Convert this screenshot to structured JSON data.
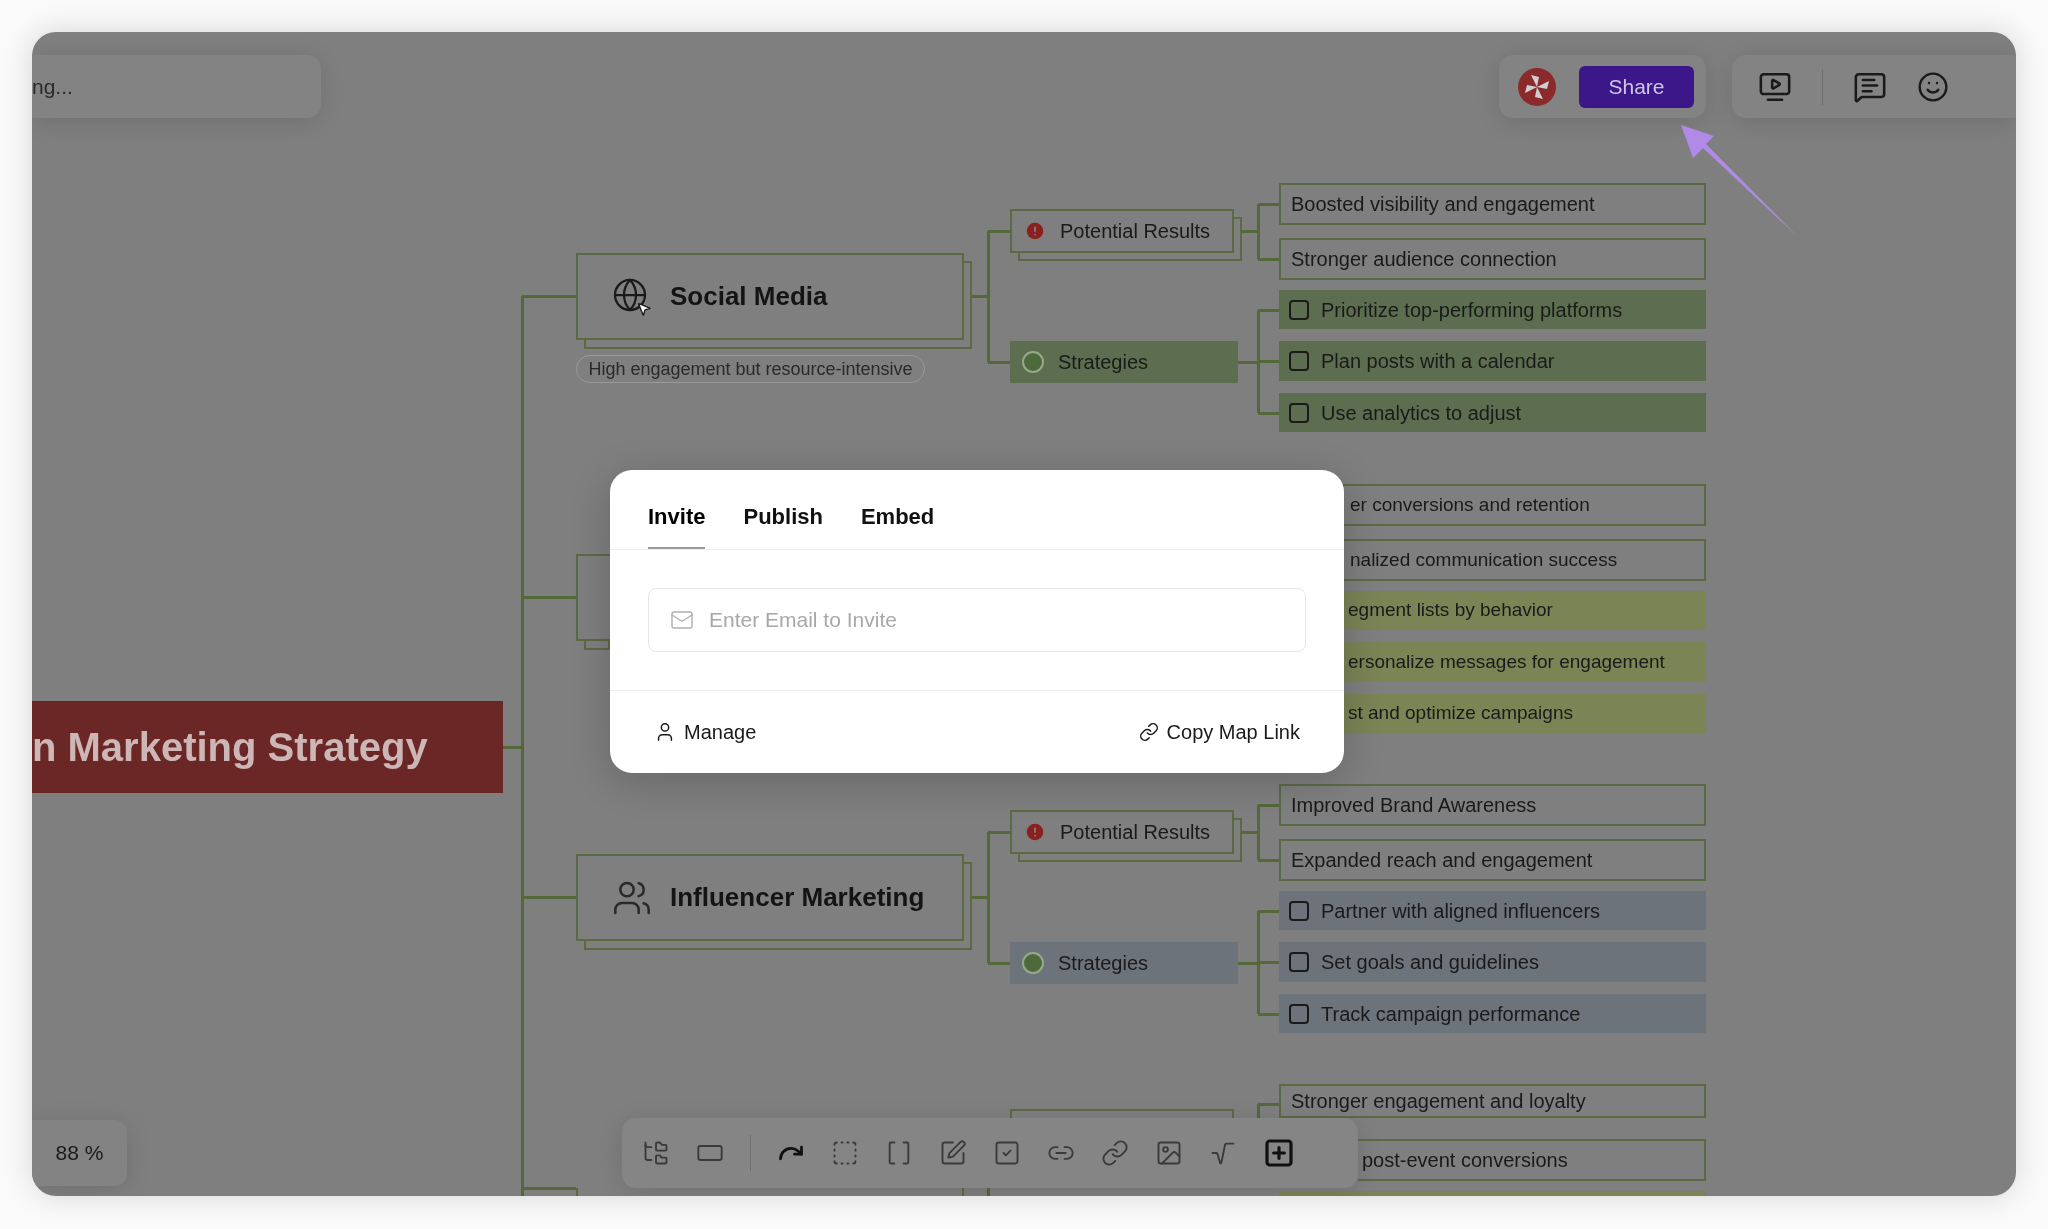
{
  "search": {
    "value": "ng..."
  },
  "share_button": "Share",
  "root": {
    "label": "n Marketing Strategy"
  },
  "branches": [
    {
      "kind": "full",
      "title": "Social Media",
      "note": "High engagement but resource-intensive",
      "results": {
        "label": "Potential Results",
        "items": [
          "Boosted visibility and engagement",
          "Stronger audience connection"
        ]
      },
      "strategies": {
        "label": "Strategies",
        "items": [
          {
            "label": "Prioritize top-performing platforms",
            "checked": false
          },
          {
            "label": "Plan posts with a calendar",
            "checked": false
          },
          {
            "label": "Use analytics to adjust",
            "checked": false
          }
        ]
      }
    },
    {
      "kind": "covered",
      "results": {
        "items": [
          "er conversions and retention",
          "nalized communication success"
        ]
      },
      "strategies": {
        "items": [
          {
            "label": "egment lists by behavior"
          },
          {
            "label": "ersonalize messages for engagement"
          },
          {
            "label": "st and optimize campaigns"
          }
        ]
      }
    },
    {
      "kind": "full",
      "title": "Influencer Marketing",
      "results": {
        "label": "Potential Results",
        "items": [
          "Improved Brand Awareness",
          "Expanded reach and engagement"
        ]
      },
      "strategies": {
        "label": "Strategies",
        "items": [
          {
            "label": "Partner with aligned influencers",
            "checked": false
          },
          {
            "label": "Set goals and guidelines",
            "checked": false
          },
          {
            "label": "Track campaign performance",
            "checked": false
          }
        ]
      }
    },
    {
      "kind": "cut",
      "results": {
        "items": [
          "Stronger engagement and loyalty",
          "post-event conversions"
        ]
      }
    }
  ],
  "dialog": {
    "tabs": [
      {
        "label": "Invite",
        "selected": true
      },
      {
        "label": "Publish",
        "selected": false
      },
      {
        "label": "Embed",
        "selected": false
      }
    ],
    "email": {
      "placeholder": "Enter Email to Invite"
    },
    "manage": "Manage",
    "copy_link": "Copy Map Link"
  },
  "zoom": "88 %"
}
